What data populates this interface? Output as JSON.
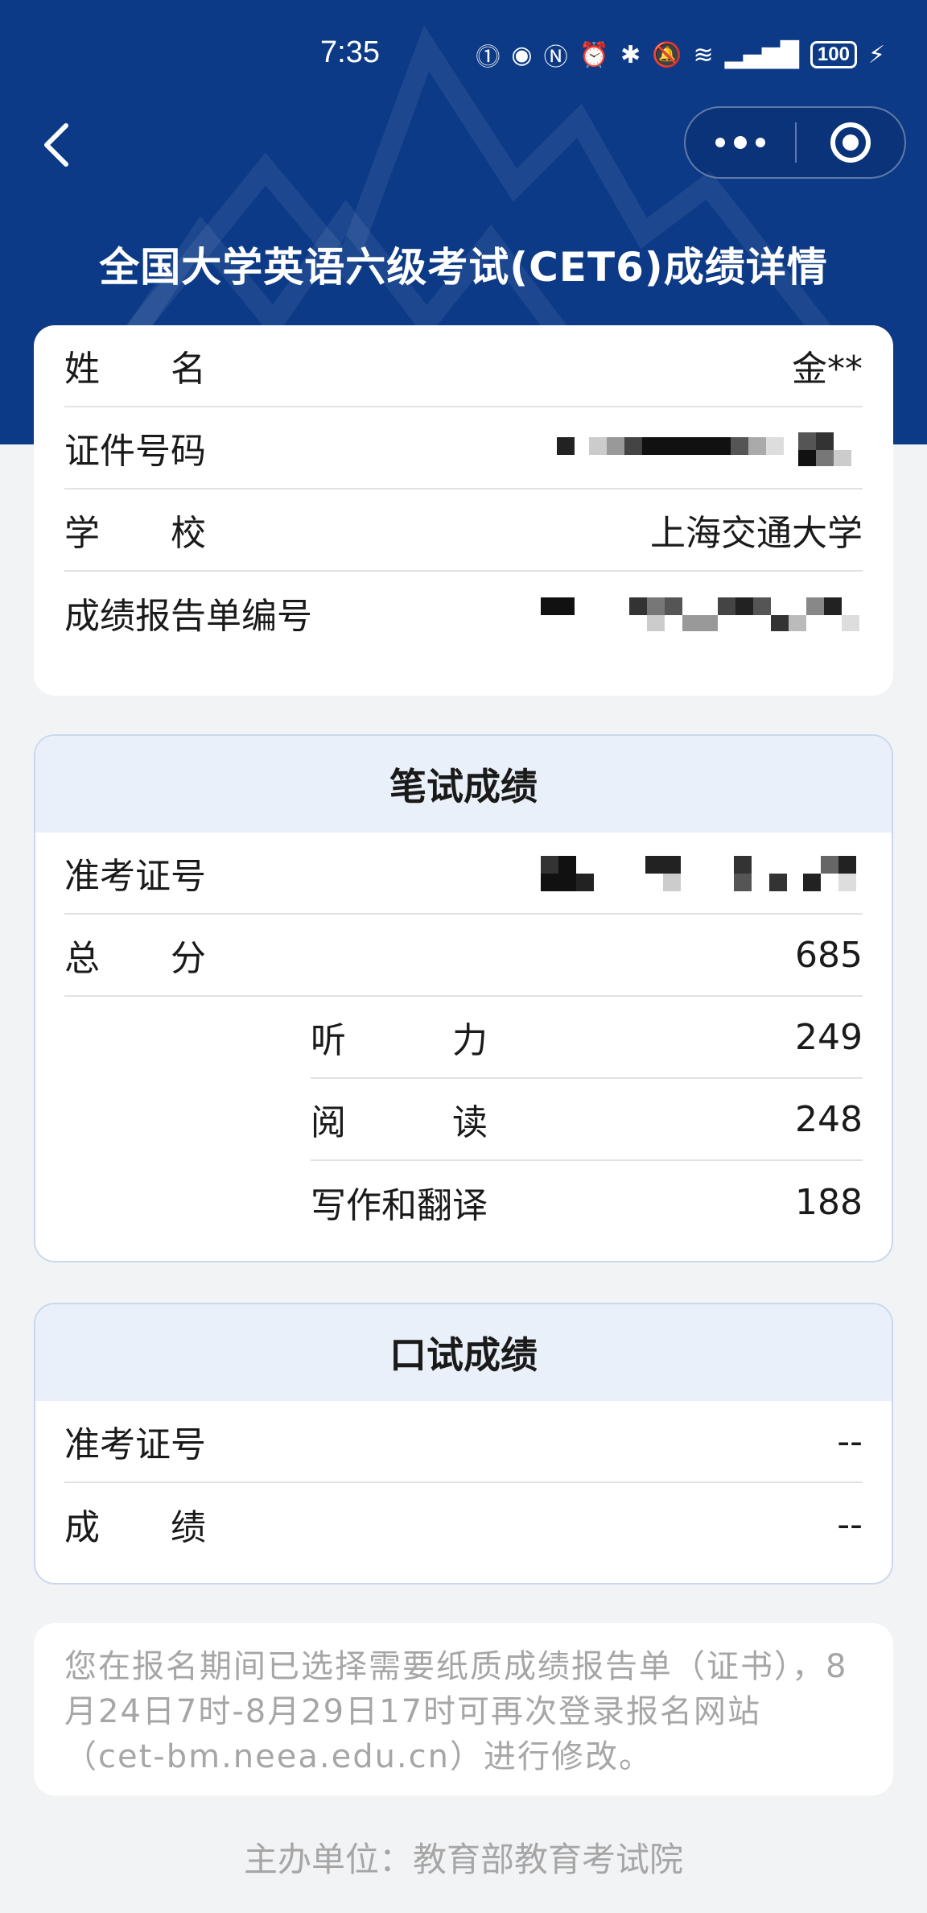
{
  "status_bar": {
    "time": "7:35",
    "icons": [
      "hd-call-icon",
      "eye-icon",
      "nfc-icon",
      "alarm-icon",
      "bluetooth-icon",
      "mute-bell-icon",
      "wifi-icon",
      "signal-5g-icon"
    ],
    "battery": "100"
  },
  "header": {
    "title": "全国大学英语六级考试(CET6)成绩详情",
    "color": "#0c3a86"
  },
  "info": {
    "name_label": "姓　　名",
    "name_value": "金**",
    "id_label": "证件号码",
    "school_label": "学　　校",
    "school_value": "上海交通大学",
    "report_label": "成绩报告单编号"
  },
  "written": {
    "title": "笔试成绩",
    "ticket_label": "准考证号",
    "total_label": "总　　分",
    "total_value": "685",
    "listening_label": "听　　　力",
    "listening_value": "249",
    "reading_label": "阅　　　读",
    "reading_value": "248",
    "writing_label": "写作和翻译",
    "writing_value": "188"
  },
  "oral": {
    "title": "口试成绩",
    "ticket_label": "准考证号",
    "ticket_value": "--",
    "score_label": "成　　绩",
    "score_value": "--"
  },
  "notice": {
    "text": "您在报名期间已选择需要纸质成绩报告单（证书），8月24日7时-8月29日17时可再次登录报名网站（cet-bm.neea.edu.cn）进行修改。"
  },
  "footer": {
    "text": "主办单位：教育部教育考试院"
  }
}
